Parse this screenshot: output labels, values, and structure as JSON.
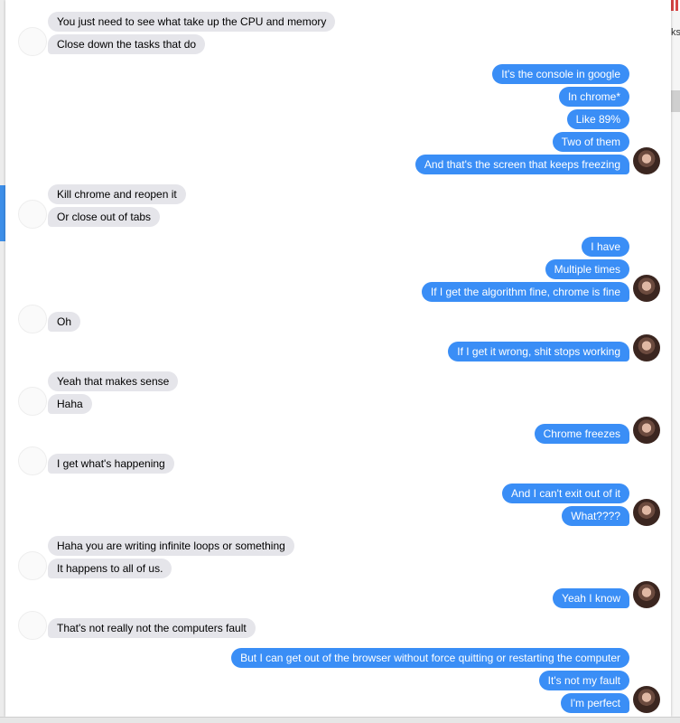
{
  "conversation": {
    "messages": [
      {
        "from": "them",
        "text": "You just need to see what take up the CPU and memory"
      },
      {
        "from": "them",
        "text": "Close down the tasks that do"
      },
      {
        "from": "me",
        "text": "It's the console in google"
      },
      {
        "from": "me",
        "text": "In chrome*"
      },
      {
        "from": "me",
        "text": "Like 89%"
      },
      {
        "from": "me",
        "text": "Two of them"
      },
      {
        "from": "me",
        "text": "And that's the screen that keeps freezing"
      },
      {
        "from": "them",
        "text": "Kill chrome and reopen it"
      },
      {
        "from": "them",
        "text": "Or close out of tabs"
      },
      {
        "from": "me",
        "text": "I have"
      },
      {
        "from": "me",
        "text": "Multiple times"
      },
      {
        "from": "me",
        "text": "If I get the algorithm fine, chrome is fine"
      },
      {
        "from": "them",
        "text": "Oh"
      },
      {
        "from": "me",
        "text": "If I get it wrong, shit stops working"
      },
      {
        "from": "them",
        "text": "Yeah that makes sense"
      },
      {
        "from": "them",
        "text": "Haha"
      },
      {
        "from": "me",
        "text": "Chrome freezes"
      },
      {
        "from": "them",
        "text": "I get what's happening"
      },
      {
        "from": "me",
        "text": "And I can't exit out of it"
      },
      {
        "from": "me",
        "text": "What????"
      },
      {
        "from": "them",
        "text": "Haha you are writing infinite loops or something"
      },
      {
        "from": "them",
        "text": "It happens to all of us."
      },
      {
        "from": "me",
        "text": "Yeah I know"
      },
      {
        "from": "them",
        "text": "That's not really not the computers fault"
      },
      {
        "from": "me",
        "text": "But I can get out of the browser without force quitting or restarting the computer"
      },
      {
        "from": "me",
        "text": "It's not my fault"
      },
      {
        "from": "me",
        "text": "I'm perfect"
      }
    ]
  },
  "background": {
    "partial_text": "ks"
  },
  "colors": {
    "incoming_bubble": "#e5e5ea",
    "outgoing_bubble": "#3a8ef6",
    "incoming_text": "#000000",
    "outgoing_text": "#ffffff"
  }
}
